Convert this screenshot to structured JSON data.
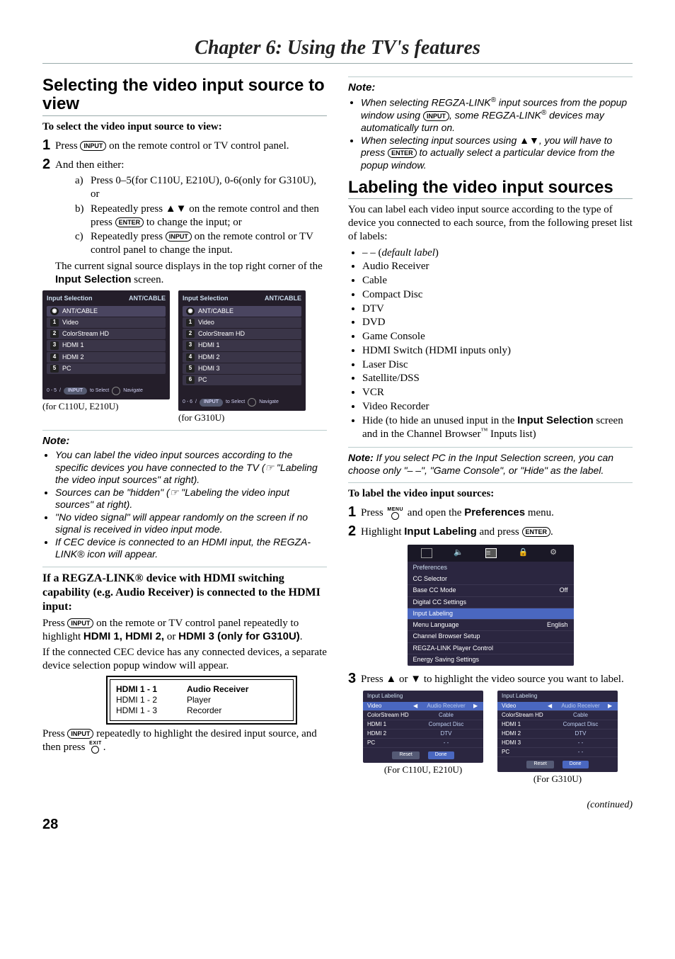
{
  "chapter_title": "Chapter 6: Using the TV's features",
  "page_number": "28",
  "continued": "(continued)",
  "left": {
    "h2": "Selecting the video input source to view",
    "sub1": "To select the video input source to view:",
    "step1_pre": "Press ",
    "step1_key": "INPUT",
    "step1_post": " on the remote control or TV control panel.",
    "step2": "And then either:",
    "a": "Press 0–5(for C110U, E210U), 0-6(only for G310U), or",
    "b_pre": "Repeatedly press ▲▼ on the remote control and then press ",
    "b_key": "ENTER",
    "b_post": " to change the input; or",
    "c_pre": "Repeatedly press ",
    "c_key": "INPUT",
    "c_post": " on the remote control or TV control panel to change the input.",
    "step2_tail_pre": "The current signal source displays in the top right corner of the ",
    "step2_tail_bold": "Input Selection",
    "step2_tail_post": " screen.",
    "osd_title": "Input Selection",
    "osd_right": "ANT/CABLE",
    "osd1_items": [
      "ANT/CABLE",
      "Video",
      "ColorStream HD",
      "HDMI 1",
      "HDMI 2",
      "PC"
    ],
    "osd2_items": [
      "ANT/CABLE",
      "Video",
      "ColorStream HD",
      "HDMI 1",
      "HDMI 2",
      "HDMI 3",
      "PC"
    ],
    "osd_foot_select": "to Select",
    "osd_foot_nav": "Navigate",
    "osd_foot_key": "INPUT",
    "osd1_range": "0 - 5",
    "osd2_range": "0 - 6",
    "osd1_cap": "(for C110U, E210U)",
    "osd2_cap": "(for G310U)",
    "note_label": "Note:",
    "notes": [
      "You can label the video input sources according to the specific devices you have connected to the TV (☞ \"Labeling the video input sources\" at right).",
      "Sources can be \"hidden\" (☞ \"Labeling the video input sources\" at right).",
      "\"No video signal\" will appear randomly on the screen if no signal is received in video input mode.",
      "If CEC device is connected to an HDMI input, the REGZA-LINK® icon will appear."
    ],
    "regza_head": "If a REGZA-LINK® device with HDMI switching capability (e.g. Audio Receiver) is connected to the HDMI input:",
    "regza_p1_pre": "Press ",
    "regza_p1_key": "INPUT",
    "regza_p1_mid": " on the remote or TV control panel repeatedly to highlight ",
    "regza_hdmi12": "HDMI 1, HDMI 2,",
    "regza_or": " or ",
    "regza_hdmi3": "HDMI 3 (only for G310U)",
    "regza_p2": "If the connected CEC device has any connected devices, a separate device selection popup window will appear.",
    "cec": [
      [
        "HDMI 1 - 1",
        "Audio Receiver"
      ],
      [
        "HDMI 1 - 2",
        "Player"
      ],
      [
        "HDMI 1 - 3",
        "Recorder"
      ]
    ],
    "regza_p3_pre": "Press ",
    "regza_p3_key": "INPUT",
    "regza_p3_mid": " repeatedly to highlight the desired input source, and then press ",
    "regza_p3_exit_top": "EXIT"
  },
  "right": {
    "note_label": "Note:",
    "notes_top": [
      "When selecting REGZA-LINK® input sources from the popup window using INPUT, some REGZA-LINK® devices may automatically turn on.",
      "When selecting input sources using ▲▼, you will have to press ENTER to actually select a particular device from the popup window."
    ],
    "note_top_raw1_a": "When selecting REGZA-LINK",
    "note_top_raw1_b": " input sources from the popup window using ",
    "note_top_raw1_key": "INPUT",
    "note_top_raw1_c": ", some REGZA-LINK",
    "note_top_raw1_d": " devices may automatically turn on.",
    "note_top_raw2_a": "When selecting input sources using ▲▼, you will have to press ",
    "note_top_raw2_key": "ENTER",
    "note_top_raw2_b": " to actually select a particular device from the popup window.",
    "h2": "Labeling the video input sources",
    "intro": "You can label each video input source according to the type of device you connected to each source, from the following preset list of labels:",
    "labels_first_pre": "– – (",
    "labels_first_em": "default label",
    "labels_first_post": ")",
    "labels": [
      "Audio Receiver",
      "Cable",
      "Compact Disc",
      "DTV",
      "DVD",
      "Game Console",
      "HDMI Switch (HDMI inputs only)",
      "Laser Disc",
      "Satellite/DSS",
      "VCR",
      "Video Recorder"
    ],
    "labels_hide_pre": "Hide (to hide an unused input in the ",
    "labels_hide_bold": "Input Selection",
    "labels_hide_mid": " screen and in the Channel Browser",
    "labels_hide_post": " Inputs list)",
    "note2_label": "Note:",
    "note2_body": " If you select PC in the Input Selection screen, you can choose only \"– –\", \"Game Console\", or \"Hide\" as the label.",
    "sub2": "To label the video input sources:",
    "s1_pre": "Press ",
    "s1_menu": "MENU",
    "s1_mid": " and open the ",
    "s1_bold": "Preferences",
    "s1_post": " menu.",
    "s2_pre": "Highlight ",
    "s2_bold": "Input Labeling",
    "s2_mid": " and press ",
    "s2_key": "ENTER",
    "prefs": {
      "header": "Preferences",
      "rows": [
        [
          "CC Selector",
          ""
        ],
        [
          "Base CC Mode",
          "Off"
        ],
        [
          "Digital CC Settings",
          ""
        ],
        [
          "Input Labeling",
          ""
        ],
        [
          "Menu Language",
          "English"
        ],
        [
          "Channel Browser Setup",
          ""
        ],
        [
          "REGZA-LINK Player Control",
          ""
        ],
        [
          "Energy Saving Settings",
          ""
        ]
      ],
      "active_index": 3
    },
    "s3": "Press ▲ or ▼ to highlight the video source you want to label.",
    "il_header": "Input Labeling",
    "il1_rows": [
      [
        "Video",
        "Audio Receiver"
      ],
      [
        "ColorStream HD",
        "Cable"
      ],
      [
        "HDMI 1",
        "Compact Disc"
      ],
      [
        "HDMI 2",
        "DTV"
      ],
      [
        "PC",
        "- -"
      ]
    ],
    "il2_rows": [
      [
        "Video",
        "Audio Receiver"
      ],
      [
        "ColorStream HD",
        "Cable"
      ],
      [
        "HDMI 1",
        "Compact Disc"
      ],
      [
        "HDMI 2",
        "DTV"
      ],
      [
        "HDMI 3",
        "- -"
      ],
      [
        "PC",
        "- -"
      ]
    ],
    "il_reset": "Reset",
    "il_done": "Done",
    "il1_cap": "(For C110U, E210U)",
    "il2_cap": "(For G310U)"
  }
}
